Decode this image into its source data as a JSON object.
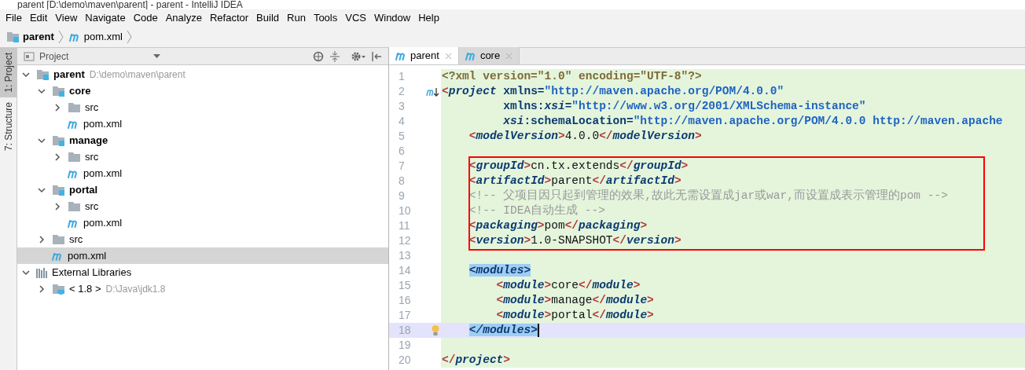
{
  "window": {
    "title": "parent [D:\\demo\\maven\\parent] - parent - IntelliJ IDEA"
  },
  "menu": [
    "File",
    "Edit",
    "View",
    "Navigate",
    "Code",
    "Analyze",
    "Refactor",
    "Build",
    "Run",
    "Tools",
    "VCS",
    "Window",
    "Help"
  ],
  "breadcrumb": [
    {
      "label": "parent",
      "kind": "module"
    },
    {
      "label": "pom.xml",
      "kind": "maven"
    }
  ],
  "tool_strip": [
    {
      "label": "1: Project",
      "selected": true
    },
    {
      "label": "7: Structure",
      "selected": false
    }
  ],
  "project_panel": {
    "title": "Project",
    "tree": [
      {
        "label": "parent",
        "path": "D:\\demo\\maven\\parent",
        "kind": "module",
        "expanded": true,
        "selected": false,
        "children": [
          {
            "label": "core",
            "kind": "module",
            "expanded": true,
            "selected": false,
            "children": [
              {
                "label": "src",
                "kind": "folder",
                "expanded": false,
                "selected": false
              },
              {
                "label": "pom.xml",
                "kind": "maven",
                "selected": false
              }
            ]
          },
          {
            "label": "manage",
            "kind": "module",
            "expanded": true,
            "selected": false,
            "children": [
              {
                "label": "src",
                "kind": "folder",
                "expanded": false,
                "selected": false
              },
              {
                "label": "pom.xml",
                "kind": "maven",
                "selected": false
              }
            ]
          },
          {
            "label": "portal",
            "kind": "module",
            "expanded": true,
            "selected": false,
            "children": [
              {
                "label": "src",
                "kind": "folder",
                "expanded": false,
                "selected": false
              },
              {
                "label": "pom.xml",
                "kind": "maven",
                "selected": false
              }
            ]
          },
          {
            "label": "src",
            "kind": "folder",
            "expanded": false,
            "selected": false
          },
          {
            "label": "pom.xml",
            "kind": "maven",
            "selected": true
          }
        ]
      },
      {
        "label": "External Libraries",
        "kind": "libraries",
        "expanded": true,
        "selected": false,
        "children": [
          {
            "label": "< 1.8 >",
            "path": "D:\\Java\\jdk1.8",
            "kind": "jdk",
            "expanded": false,
            "selected": false
          }
        ]
      }
    ]
  },
  "editor": {
    "tabs": [
      {
        "label": "parent",
        "selected": true
      },
      {
        "label": "core",
        "selected": false
      }
    ],
    "lines": [
      {
        "number": "1",
        "tokens": [
          {
            "kind": "pi",
            "text": "<?xml version=\"1.0\" encoding=\"UTF-8\"?>"
          }
        ]
      },
      {
        "number": "2",
        "tokens": [
          {
            "kind": "punct",
            "text": "<"
          },
          {
            "kind": "tag",
            "text": "project"
          },
          {
            "kind": "attr",
            "text": " xmlns="
          },
          {
            "kind": "val",
            "text": "\"http://maven.apache.org/POM/4.0.0\""
          }
        ]
      },
      {
        "number": "3",
        "tokens": [
          {
            "kind": "attr",
            "text": "         xmlns:"
          },
          {
            "kind": "tag",
            "text": "xsi"
          },
          {
            "kind": "attr",
            "text": "="
          },
          {
            "kind": "val",
            "text": "\"http://www.w3.org/2001/XMLSchema-instance\""
          }
        ]
      },
      {
        "number": "4",
        "tokens": [
          {
            "kind": "tag",
            "text": "         xsi"
          },
          {
            "kind": "attr",
            "text": ":schemaLocation="
          },
          {
            "kind": "val",
            "text": "\"http://maven.apache.org/POM/4.0.0 http://maven.apache"
          }
        ]
      },
      {
        "number": "5",
        "tokens": [
          {
            "kind": "punct",
            "text": "    <"
          },
          {
            "kind": "tag",
            "text": "modelVersion"
          },
          {
            "kind": "punct",
            "text": ">"
          },
          {
            "kind": "text",
            "text": "4.0.0"
          },
          {
            "kind": "punct",
            "text": "</"
          },
          {
            "kind": "tag",
            "text": "modelVersion"
          },
          {
            "kind": "punct",
            "text": ">"
          }
        ]
      },
      {
        "number": "6"
      },
      {
        "number": "7",
        "framed": true,
        "tokens": [
          {
            "kind": "punct",
            "text": "    <"
          },
          {
            "kind": "tag",
            "text": "groupId"
          },
          {
            "kind": "punct",
            "text": ">"
          },
          {
            "kind": "text",
            "text": "cn.tx.extends"
          },
          {
            "kind": "punct",
            "text": "</"
          },
          {
            "kind": "tag",
            "text": "groupId"
          },
          {
            "kind": "punct",
            "text": ">"
          }
        ]
      },
      {
        "number": "8",
        "framed": true,
        "tokens": [
          {
            "kind": "punct",
            "text": "    <"
          },
          {
            "kind": "tag",
            "text": "artifactId"
          },
          {
            "kind": "punct",
            "text": ">"
          },
          {
            "kind": "text",
            "text": "parent"
          },
          {
            "kind": "punct",
            "text": "</"
          },
          {
            "kind": "tag",
            "text": "artifactId"
          },
          {
            "kind": "punct",
            "text": ">"
          }
        ]
      },
      {
        "number": "9",
        "framed": true,
        "tokens": [
          {
            "kind": "comment",
            "text": "    <!-- 父项目因只起到管理的效果,故此无需设置成jar或war,而设置成表示管理的pom -->"
          }
        ]
      },
      {
        "number": "10",
        "framed": true,
        "tokens": [
          {
            "kind": "comment",
            "text": "    <!-- IDEA自动生成 -->"
          }
        ]
      },
      {
        "number": "11",
        "framed": true,
        "tokens": [
          {
            "kind": "punct",
            "text": "    <"
          },
          {
            "kind": "tag",
            "text": "packaging"
          },
          {
            "kind": "punct",
            "text": ">"
          },
          {
            "kind": "text",
            "text": "pom"
          },
          {
            "kind": "punct",
            "text": "</"
          },
          {
            "kind": "tag",
            "text": "packaging"
          },
          {
            "kind": "punct",
            "text": ">"
          }
        ]
      },
      {
        "number": "12",
        "framed": true,
        "tokens": [
          {
            "kind": "punct",
            "text": "    <"
          },
          {
            "kind": "tag",
            "text": "version"
          },
          {
            "kind": "punct",
            "text": ">"
          },
          {
            "kind": "text",
            "text": "1.0-SNAPSHOT"
          },
          {
            "kind": "punct",
            "text": "</"
          },
          {
            "kind": "tag",
            "text": "version"
          },
          {
            "kind": "punct",
            "text": ">"
          }
        ]
      },
      {
        "number": "13"
      },
      {
        "number": "14",
        "tokens": [
          {
            "kind": "match",
            "text": "    <modules>"
          }
        ]
      },
      {
        "number": "15",
        "tokens": [
          {
            "kind": "punct",
            "text": "        <"
          },
          {
            "kind": "tag",
            "text": "module"
          },
          {
            "kind": "punct",
            "text": ">"
          },
          {
            "kind": "text",
            "text": "core"
          },
          {
            "kind": "punct",
            "text": "</"
          },
          {
            "kind": "tag",
            "text": "module"
          },
          {
            "kind": "punct",
            "text": ">"
          }
        ]
      },
      {
        "number": "16",
        "tokens": [
          {
            "kind": "punct",
            "text": "        <"
          },
          {
            "kind": "tag",
            "text": "module"
          },
          {
            "kind": "punct",
            "text": ">"
          },
          {
            "kind": "text",
            "text": "manage"
          },
          {
            "kind": "punct",
            "text": "</"
          },
          {
            "kind": "tag",
            "text": "module"
          },
          {
            "kind": "punct",
            "text": ">"
          }
        ]
      },
      {
        "number": "17",
        "tokens": [
          {
            "kind": "punct",
            "text": "        <"
          },
          {
            "kind": "tag",
            "text": "module"
          },
          {
            "kind": "punct",
            "text": ">"
          },
          {
            "kind": "text",
            "text": "portal"
          },
          {
            "kind": "punct",
            "text": "</"
          },
          {
            "kind": "tag",
            "text": "module"
          },
          {
            "kind": "punct",
            "text": ">"
          }
        ]
      },
      {
        "number": "18",
        "current": true,
        "tokens": [
          {
            "kind": "match",
            "text": "    </modules>"
          }
        ]
      },
      {
        "number": "19"
      },
      {
        "number": "20",
        "tokens": [
          {
            "kind": "punct",
            "text": "</"
          },
          {
            "kind": "tag",
            "text": "project"
          },
          {
            "kind": "punct",
            "text": ">"
          }
        ]
      }
    ]
  }
}
